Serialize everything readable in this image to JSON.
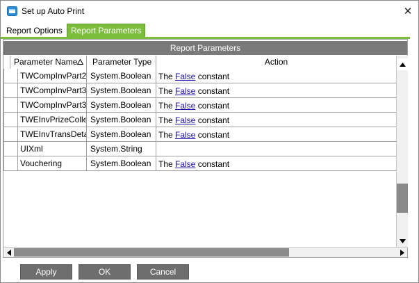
{
  "window": {
    "title": "Set up Auto Print",
    "icon": "app-window-icon",
    "close_glyph": "✕"
  },
  "tabs": [
    {
      "label": "Report Options",
      "active": false
    },
    {
      "label": "Report Parameters",
      "active": true
    }
  ],
  "grid": {
    "caption": "Report Parameters",
    "columns": {
      "name": "Parameter Name",
      "type": "Parameter Type",
      "action": "Action"
    },
    "sort_glyph": "Δ",
    "rows": [
      {
        "name": "TWCompInvPart2",
        "type": "System.Boolean",
        "action_prefix": "The ",
        "action_link": "False",
        "action_suffix": " constant"
      },
      {
        "name": "TWCompInvPart3",
        "type": "System.Boolean",
        "action_prefix": "The ",
        "action_link": "False",
        "action_suffix": " constant"
      },
      {
        "name": "TWCompInvPart3",
        "type": "System.Boolean",
        "action_prefix": "The ",
        "action_link": "False",
        "action_suffix": " constant"
      },
      {
        "name": "TWEInvPrizeColle",
        "type": "System.Boolean",
        "action_prefix": "The ",
        "action_link": "False",
        "action_suffix": " constant"
      },
      {
        "name": "TWEInvTransDeta",
        "type": "System.Boolean",
        "action_prefix": "The ",
        "action_link": "False",
        "action_suffix": " constant"
      },
      {
        "name": "UIXml",
        "type": "System.String",
        "action_prefix": "",
        "action_link": "",
        "action_suffix": ""
      },
      {
        "name": "Vouchering",
        "type": "System.Boolean",
        "action_prefix": "The ",
        "action_link": "False",
        "action_suffix": " constant"
      }
    ]
  },
  "buttons": {
    "apply": "Apply",
    "ok": "OK",
    "cancel": "Cancel"
  },
  "colors": {
    "accent_green": "#7cbe3c",
    "caption_gray": "#7a7a7a",
    "button_gray": "#6e6e6e",
    "link_blue": "#1a0dab"
  }
}
